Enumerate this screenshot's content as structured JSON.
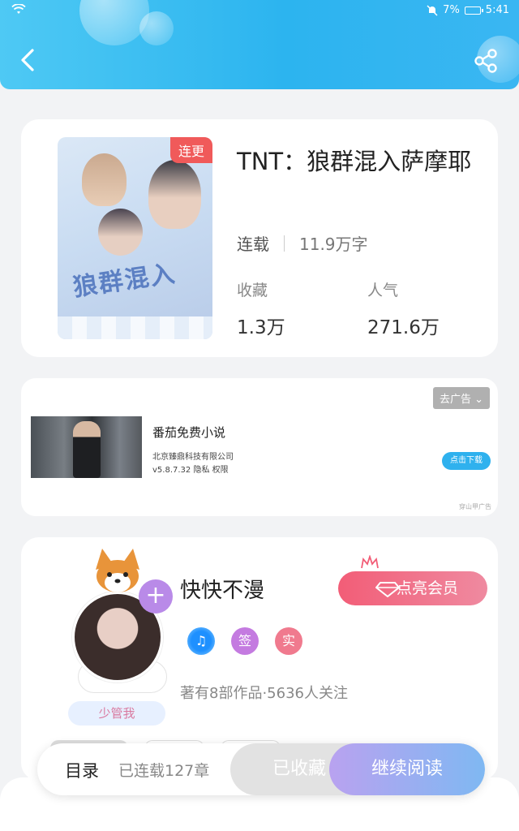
{
  "status": {
    "battery": "7%",
    "time": "5:41"
  },
  "book": {
    "tag": "连更",
    "title": "TNT：狼群混入萨摩耶",
    "status": "连载",
    "words": "11.9万字",
    "favorites_label": "收藏",
    "favorites_value": "1.3万",
    "popularity_label": "人气",
    "popularity_value": "271.6万"
  },
  "ad": {
    "remove_label": "去广告 ⌄",
    "title": "番茄免费小说",
    "company": "北京臻鼎科技有限公司",
    "version": "v5.8.7.32  隐私  权限",
    "download_label": "点击下载",
    "source": "穿山甲广告"
  },
  "author": {
    "name": "快快不漫",
    "nickname_tag": "少管我",
    "vip_label": "点亮会员",
    "badges": [
      "♫",
      "签",
      "实"
    ],
    "stats": "著有8部作品·5636人关注"
  },
  "bottom_bar": {
    "toc_label": "目录",
    "chapters": "已连载127章",
    "collected_label": "已收藏",
    "read_label": "继续阅读"
  },
  "colors": {
    "header": "#2cb4ef",
    "tag": "#f05a5a",
    "vip": "#f25d77",
    "download": "#2fb1ee"
  }
}
